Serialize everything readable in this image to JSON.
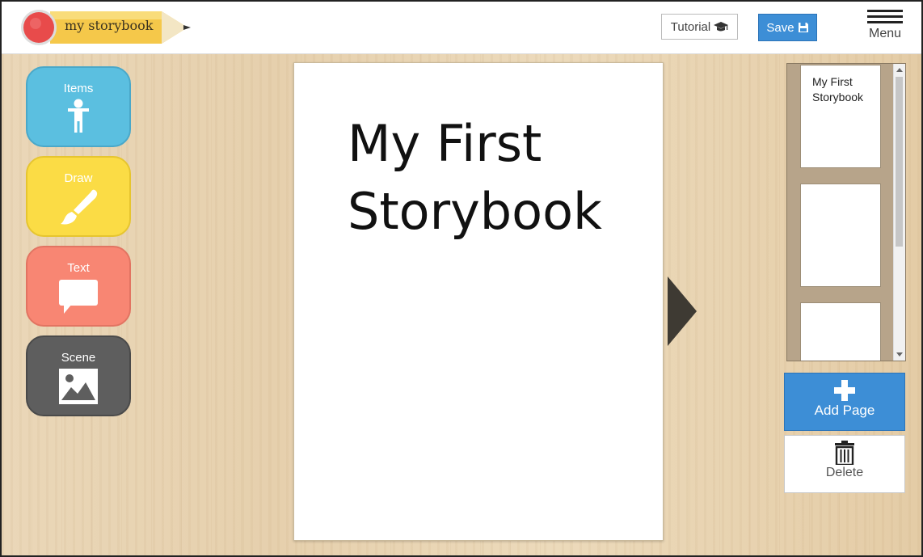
{
  "header": {
    "logo_text": "my storybook",
    "tutorial_label": "Tutorial",
    "save_label": "Save",
    "menu_label": "Menu"
  },
  "tools": {
    "items": {
      "label": "Items",
      "color": "#5bbfe0",
      "icon": "person-icon"
    },
    "draw": {
      "label": "Draw",
      "color": "#fbdc45",
      "icon": "paintbrush-icon"
    },
    "text": {
      "label": "Text",
      "color": "#f88673",
      "icon": "speech-bubble-icon"
    },
    "scene": {
      "label": "Scene",
      "color": "#5e5e5e",
      "icon": "image-icon"
    }
  },
  "page": {
    "title": "My First Storybook"
  },
  "pages_panel": {
    "thumbnails": [
      {
        "text": "My First Storybook"
      },
      {
        "text": ""
      },
      {
        "text": ""
      }
    ]
  },
  "actions": {
    "add_page_label": "Add Page",
    "delete_label": "Delete"
  },
  "colors": {
    "accent_blue": "#3d8ed6"
  }
}
